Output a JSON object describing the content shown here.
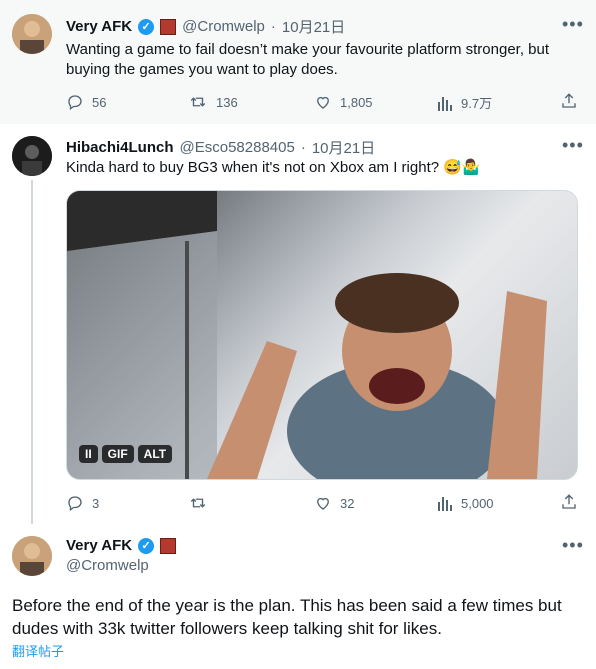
{
  "tweet1": {
    "name": "Very AFK",
    "handle": "@Cromwelp",
    "sep": "·",
    "date": "10月21日",
    "text": "Wanting a game to fail doesn’t make your favourite platform stronger, but buying the games you want to play does.",
    "replies": "56",
    "retweets": "136",
    "likes": "1,805",
    "views": "9.7万"
  },
  "tweet2": {
    "name": "Hibachi4Lunch",
    "handle": "@Esco58288405",
    "sep": "·",
    "date": "10月21日",
    "text": "Kinda hard to buy BG3 when it's not on Xbox am I right? 😅🤷‍♂️",
    "media_controls": [
      "II",
      "GIF",
      "ALT"
    ],
    "replies": "3",
    "retweets": "",
    "likes": "32",
    "views": "5,000"
  },
  "tweet3": {
    "name": "Very AFK",
    "handle": "@Cromwelp",
    "text": "Before the end of the year is the plan. This has been said a few times but dudes with 33k twitter followers keep talking shit for likes.",
    "translate": "翻译帖子"
  },
  "icons": {
    "more": "more-icon",
    "reply": "reply-icon",
    "retweet": "retweet-icon",
    "like": "like-icon",
    "views": "views-icon",
    "share": "share-icon",
    "verified": "verified-icon",
    "flag": "flag-icon"
  },
  "colors": {
    "accent": "#1d9bf0",
    "muted": "#536471",
    "highlight_bg": "#f7f9f9"
  }
}
